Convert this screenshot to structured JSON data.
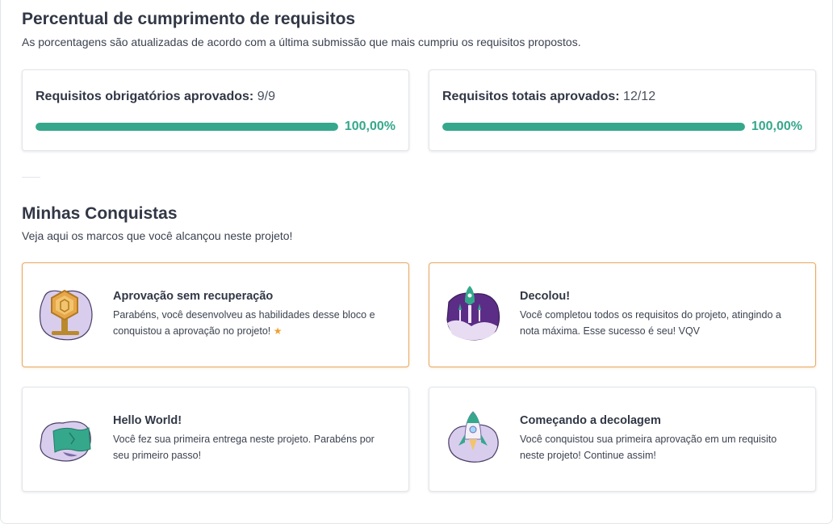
{
  "requirements_section": {
    "title": "Percentual de cumprimento de requisitos",
    "subtitle": "As porcentagens são atualizadas de acordo com a última submissão que mais cumpriu os requisitos propostos.",
    "cards": [
      {
        "label": "Requisitos obrigatórios aprovados:",
        "count": "9/9",
        "percent_text": "100,00%",
        "progress": 1.0
      },
      {
        "label": "Requisitos totais aprovados:",
        "count": "12/12",
        "percent_text": "100,00%",
        "progress": 1.0
      }
    ],
    "accent_color": "#35a88c"
  },
  "achievements_section": {
    "title": "Minhas Conquistas",
    "subtitle": "Veja aqui os marcos que você alcançou neste projeto!",
    "items": [
      {
        "title": "Aprovação sem recuperação",
        "description": "Parabéns, você desenvolveu as habilidades desse bloco e conquistou a aprovação no projeto!",
        "icon": "gold-medal-icon",
        "highlighted": true
      },
      {
        "title": "Decolou!",
        "description": "Você completou todos os requisitos do projeto, atingindo a nota máxima. Esse sucesso é seu! VQV",
        "icon": "rocket-launch-icon",
        "highlighted": true
      },
      {
        "title": "Hello World!",
        "description": "Você fez sua primeira entrega neste projeto. Parabéns por seu primeiro passo!",
        "icon": "flag-icon",
        "highlighted": false
      },
      {
        "title": "Começando a decolagem",
        "description": "Você conquistou sua primeira aprovação em um requisito neste projeto! Continue assim!",
        "icon": "rocket-icon",
        "highlighted": false
      }
    ],
    "highlight_color": "#e7a760"
  }
}
